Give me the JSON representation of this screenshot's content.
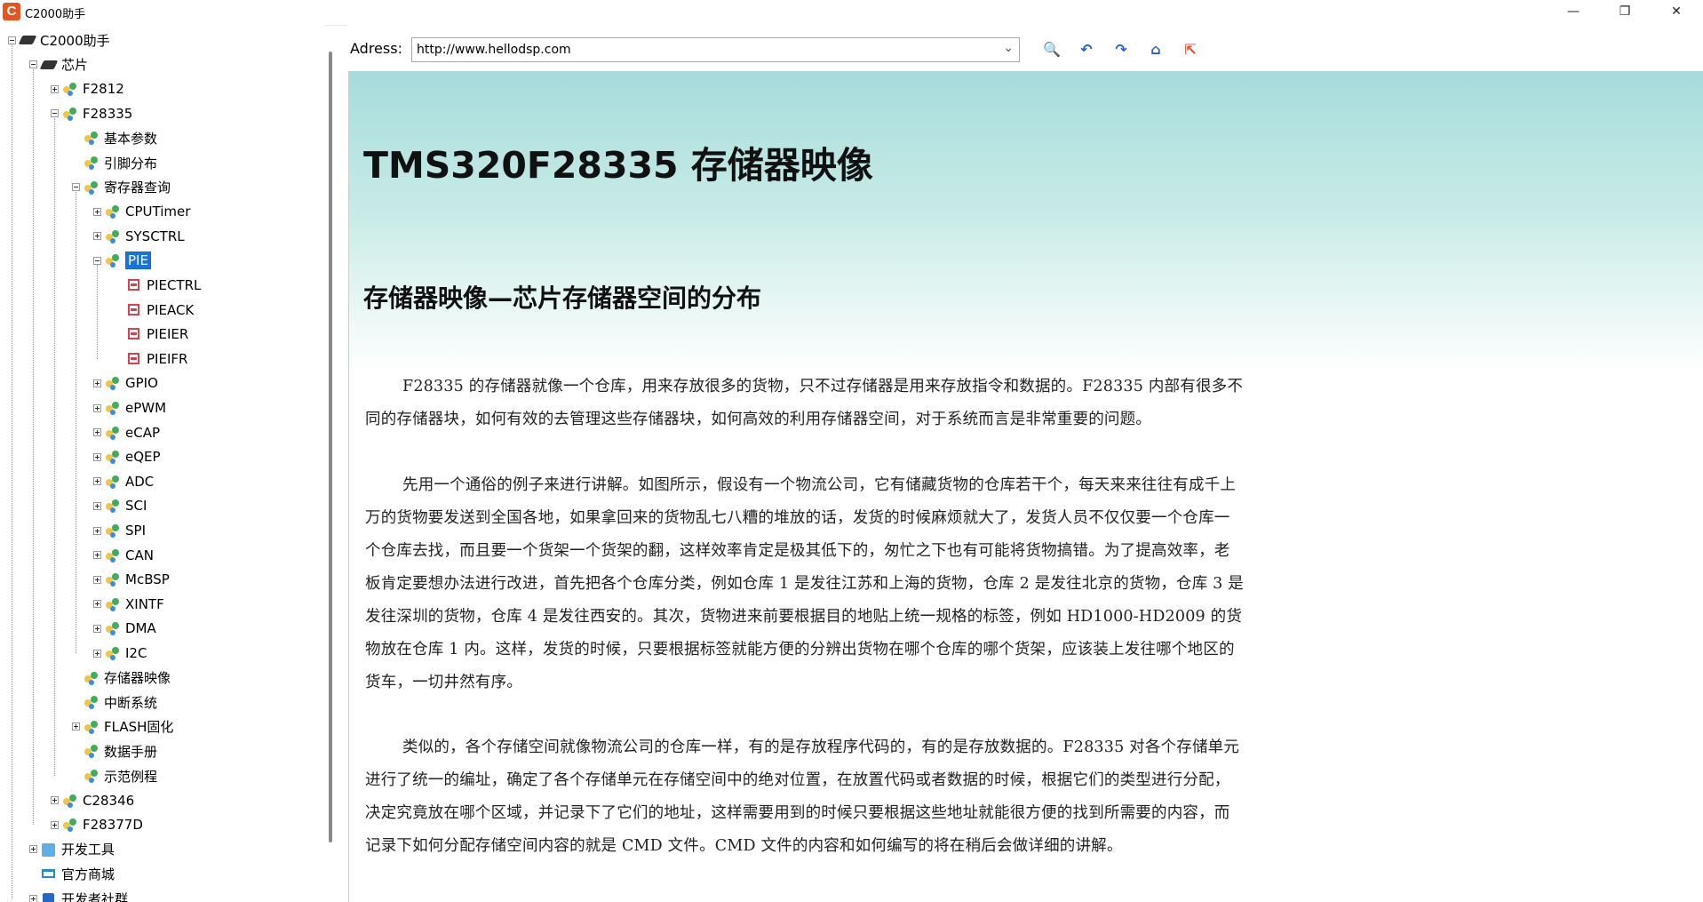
{
  "window": {
    "title": "C2000助手",
    "app_icon_letter": "C",
    "minimize": "—",
    "maximize": "❐",
    "close": "✕"
  },
  "tree": {
    "items": [
      {
        "label": "C2000助手",
        "icon": "chip-icon",
        "expander": "minus"
      },
      {
        "label": "芯片",
        "icon": "chip-icon",
        "expander": "minus"
      },
      {
        "label": "F2812",
        "icon": "group-icon",
        "expander": "plus"
      },
      {
        "label": "F28335",
        "icon": "group-icon",
        "expander": "minus"
      },
      {
        "label": "基本参数",
        "icon": "group-icon",
        "expander": "none"
      },
      {
        "label": "引脚分布",
        "icon": "group-icon",
        "expander": "none"
      },
      {
        "label": "寄存器查询",
        "icon": "group-icon",
        "expander": "minus"
      },
      {
        "label": "CPUTimer",
        "icon": "group-icon",
        "expander": "plus"
      },
      {
        "label": "SYSCTRL",
        "icon": "group-icon",
        "expander": "plus"
      },
      {
        "label": "PIE",
        "icon": "group-icon",
        "expander": "minus",
        "selected": true
      },
      {
        "label": "PIECTRL",
        "icon": "register-icon",
        "expander": "none"
      },
      {
        "label": "PIEACK",
        "icon": "register-icon",
        "expander": "none"
      },
      {
        "label": "PIEIER",
        "icon": "register-icon",
        "expander": "none"
      },
      {
        "label": "PIEIFR",
        "icon": "register-icon",
        "expander": "none"
      },
      {
        "label": "GPIO",
        "icon": "group-icon",
        "expander": "plus"
      },
      {
        "label": "ePWM",
        "icon": "group-icon",
        "expander": "plus"
      },
      {
        "label": "eCAP",
        "icon": "group-icon",
        "expander": "plus"
      },
      {
        "label": "eQEP",
        "icon": "group-icon",
        "expander": "plus"
      },
      {
        "label": "ADC",
        "icon": "group-icon",
        "expander": "plus"
      },
      {
        "label": "SCI",
        "icon": "group-icon",
        "expander": "plus"
      },
      {
        "label": "SPI",
        "icon": "group-icon",
        "expander": "plus"
      },
      {
        "label": "CAN",
        "icon": "group-icon",
        "expander": "plus"
      },
      {
        "label": "McBSP",
        "icon": "group-icon",
        "expander": "plus"
      },
      {
        "label": "XINTF",
        "icon": "group-icon",
        "expander": "plus"
      },
      {
        "label": "DMA",
        "icon": "group-icon",
        "expander": "plus"
      },
      {
        "label": "I2C",
        "icon": "group-icon",
        "expander": "plus"
      },
      {
        "label": "存储器映像",
        "icon": "group-icon",
        "expander": "none"
      },
      {
        "label": "中断系统",
        "icon": "group-icon",
        "expander": "none"
      },
      {
        "label": "FLASH固化",
        "icon": "group-icon",
        "expander": "plus"
      },
      {
        "label": "数据手册",
        "icon": "group-icon",
        "expander": "none"
      },
      {
        "label": "示范例程",
        "icon": "group-icon",
        "expander": "none"
      },
      {
        "label": "C28346",
        "icon": "group-icon",
        "expander": "plus"
      },
      {
        "label": "F28377D",
        "icon": "group-icon",
        "expander": "plus"
      },
      {
        "label": "开发工具",
        "icon": "tools-icon",
        "expander": "plus"
      },
      {
        "label": "官方商城",
        "icon": "shop-icon",
        "expander": "none"
      },
      {
        "label": "开发者社群",
        "icon": "user-icon",
        "expander": "plus"
      }
    ]
  },
  "addressbar": {
    "label": "Adress:",
    "url": "http://www.hellodsp.com",
    "dropdown_glyph": "⌄",
    "buttons": [
      {
        "name": "search-icon",
        "glyph": "🔍",
        "color": "#f5c400"
      },
      {
        "name": "back-icon",
        "glyph": "↶",
        "color": "#2a5fd1"
      },
      {
        "name": "forward-icon",
        "glyph": "↷",
        "color": "#2a5fd1"
      },
      {
        "name": "home-icon",
        "glyph": "⌂",
        "color": "#2a5fd1"
      },
      {
        "name": "exit-icon",
        "glyph": "⇱",
        "color": "#e84a2a"
      }
    ]
  },
  "page": {
    "title": "TMS320F28335 存储器映像",
    "subtitle": "存储器映像—芯片存储器空间的分布",
    "paragraphs": [
      "F28335 的存储器就像一个仓库，用来存放很多的货物，只不过存储器是用来存放指令和数据的。F28335 内部有很多不同的存储器块，如何有效的去管理这些存储器块，如何高效的利用存储器空间，对于系统而言是非常重要的问题。",
      "先用一个通俗的例子来进行讲解。如图所示，假设有一个物流公司，它有储藏货物的仓库若干个，每天来来往往有成千上万的货物要发送到全国各地，如果拿回来的货物乱七八糟的堆放的话，发货的时候麻烦就大了，发货人员不仅仅要一个仓库一个仓库去找，而且要一个货架一个货架的翻，这样效率肯定是极其低下的，匆忙之下也有可能将货物搞错。为了提高效率，老板肯定要想办法进行改进，首先把各个仓库分类，例如仓库 1 是发往江苏和上海的货物，仓库 2 是发往北京的货物，仓库 3 是发往深圳的货物，仓库 4 是发往西安的。其次，货物进来前要根据目的地贴上统一规格的标签，例如 HD1000-HD2009 的货物放在仓库 1 内。这样，发货的时候，只要根据标签就能方便的分辨出货物在哪个仓库的哪个货架，应该装上发往哪个地区的货车，一切井然有序。",
      "类似的，各个存储空间就像物流公司的仓库一样，有的是存放程序代码的，有的是存放数据的。F28335 对各个存储单元进行了统一的编址，确定了各个存储单元在存储空间中的绝对位置，在放置代码或者数据的时候，根据它们的类型进行分配，决定究竟放在哪个区域，并记录下了它们的地址，这样需要用到的时候只要根据这些地址就能很方便的找到所需要的内容，而记录下如何分配存储空间内容的就是 CMD 文件。CMD 文件的内容和如何编写的将在稍后会做详细的讲解。"
    ]
  }
}
